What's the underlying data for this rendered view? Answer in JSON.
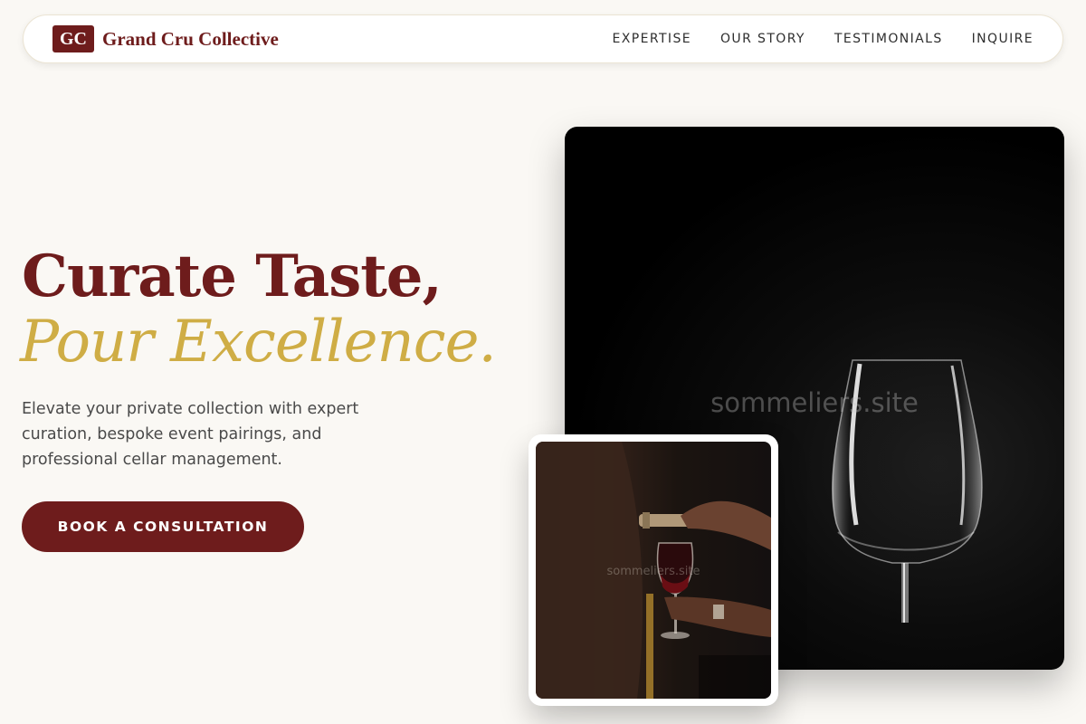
{
  "brand": {
    "badge": "GC",
    "name": "Grand Cru Collective"
  },
  "nav": {
    "links": [
      {
        "label": "EXPERTISE"
      },
      {
        "label": "OUR STORY"
      },
      {
        "label": "TESTIMONIALS"
      },
      {
        "label": "INQUIRE"
      }
    ]
  },
  "hero": {
    "title": "Curate Taste,",
    "title_accent": "Pour Excellence.",
    "description": "Elevate your private collection with expert curation, bespoke event pairings, and professional cellar management.",
    "cta_label": "BOOK A CONSULTATION"
  },
  "images": {
    "main_watermark": "sommeliers.site",
    "inset_watermark": "sommeliers.site"
  },
  "colors": {
    "brand": "#6e1c1c",
    "accent_gold": "#cfad45",
    "background": "#faf8f4"
  }
}
